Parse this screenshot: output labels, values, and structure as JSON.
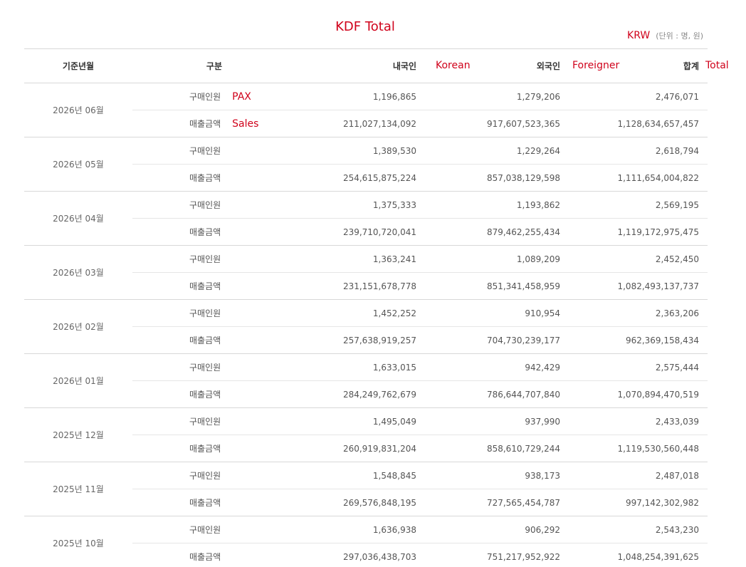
{
  "title": "KDF Total",
  "unit": {
    "en": "KRW",
    "ko": "(단위 : 명, 원)"
  },
  "headers": {
    "month": "기준년월",
    "type": "구분",
    "korean": "내국인",
    "korean_en": "Korean",
    "foreigner": "외국인",
    "foreigner_en": "Foreigner",
    "total": "합계",
    "total_en": "Total"
  },
  "type_labels": {
    "pax": "구매인원",
    "pax_en": "PAX",
    "sales": "매출금액",
    "sales_en": "Sales"
  },
  "rows": [
    {
      "month": "2026년 06월",
      "pax": [
        "1,196,865",
        "1,279,206",
        "2,476,071"
      ],
      "sales": [
        "211,027,134,092",
        "917,607,523,365",
        "1,128,634,657,457"
      ]
    },
    {
      "month": "2026년 05월",
      "pax": [
        "1,389,530",
        "1,229,264",
        "2,618,794"
      ],
      "sales": [
        "254,615,875,224",
        "857,038,129,598",
        "1,111,654,004,822"
      ]
    },
    {
      "month": "2026년 04월",
      "pax": [
        "1,375,333",
        "1,193,862",
        "2,569,195"
      ],
      "sales": [
        "239,710,720,041",
        "879,462,255,434",
        "1,119,172,975,475"
      ]
    },
    {
      "month": "2026년 03월",
      "pax": [
        "1,363,241",
        "1,089,209",
        "2,452,450"
      ],
      "sales": [
        "231,151,678,778",
        "851,341,458,959",
        "1,082,493,137,737"
      ]
    },
    {
      "month": "2026년 02월",
      "pax": [
        "1,452,252",
        "910,954",
        "2,363,206"
      ],
      "sales": [
        "257,638,919,257",
        "704,730,239,177",
        "962,369,158,434"
      ]
    },
    {
      "month": "2026년 01월",
      "pax": [
        "1,633,015",
        "942,429",
        "2,575,444"
      ],
      "sales": [
        "284,249,762,679",
        "786,644,707,840",
        "1,070,894,470,519"
      ]
    },
    {
      "month": "2025년 12월",
      "pax": [
        "1,495,049",
        "937,990",
        "2,433,039"
      ],
      "sales": [
        "260,919,831,204",
        "858,610,729,244",
        "1,119,530,560,448"
      ]
    },
    {
      "month": "2025년 11월",
      "pax": [
        "1,548,845",
        "938,173",
        "2,487,018"
      ],
      "sales": [
        "269,576,848,195",
        "727,565,454,787",
        "997,142,302,982"
      ]
    },
    {
      "month": "2025년 10월",
      "pax": [
        "1,636,938",
        "906,292",
        "2,543,230"
      ],
      "sales": [
        "297,036,438,703",
        "751,217,952,922",
        "1,048,254,391,625"
      ]
    }
  ]
}
